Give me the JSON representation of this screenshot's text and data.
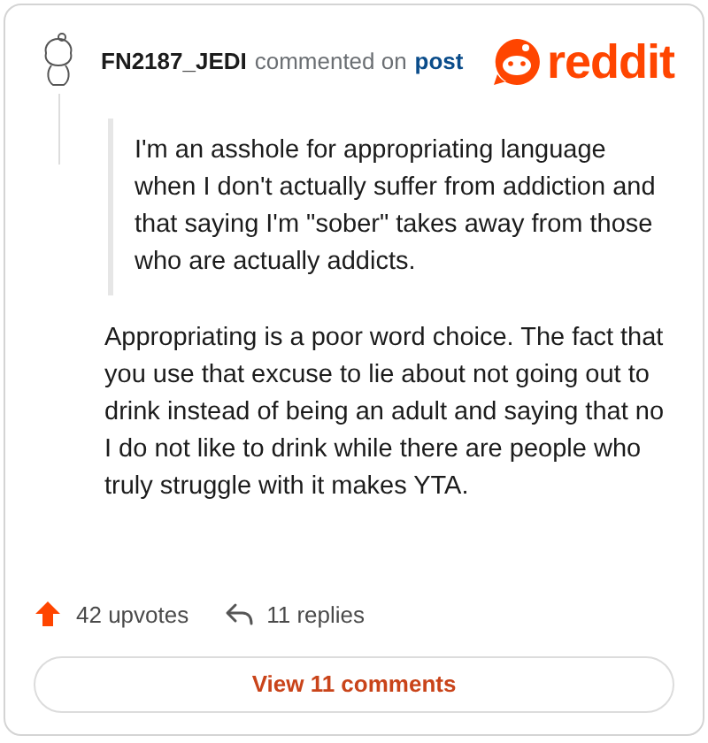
{
  "author": "FN2187_JEDI",
  "action": "commented on",
  "link": "post",
  "logo": "reddit",
  "quote": "I'm an asshole for appropriating language when I don't actually suffer from addiction and that saying I'm \"sober\" takes away from those who are actually addicts.",
  "comment": "Appropriating is a poor word choice. The fact that you use that excuse to lie about not going out to drink instead of being an adult and saying that no I do not like to drink while there are people who truly struggle with it makes YTA.",
  "upvotes": "42 upvotes",
  "replies": "11 replies",
  "button": "View 11 comments"
}
